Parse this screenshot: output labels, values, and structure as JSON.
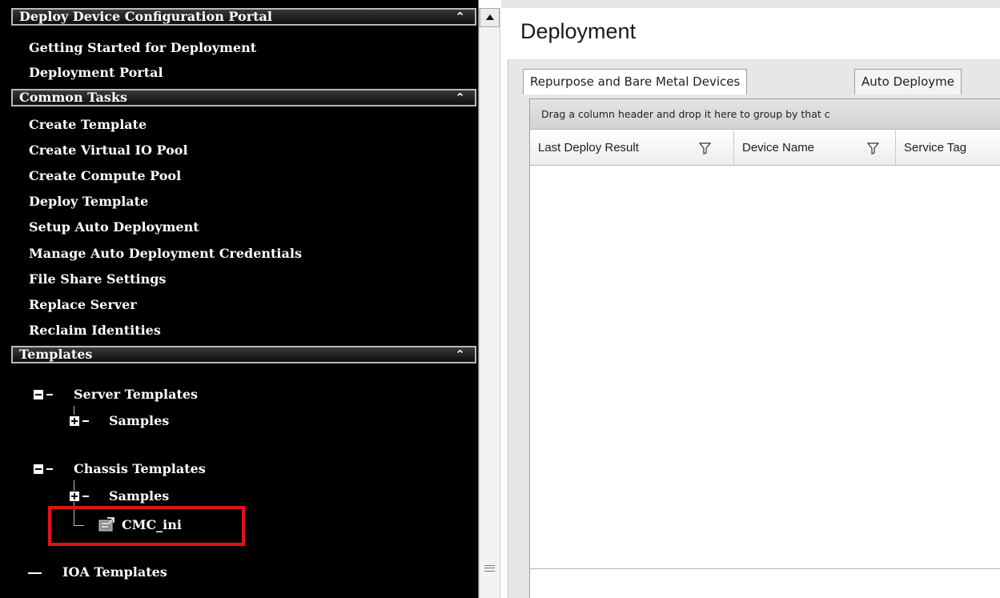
{
  "sidebar": {
    "sections": [
      {
        "title": "Deploy Device Configuration Portal",
        "items": [
          "Getting Started for Deployment",
          "Deployment Portal"
        ]
      },
      {
        "title": "Common Tasks",
        "items": [
          "Create Template",
          "Create Virtual IO Pool",
          "Create Compute Pool",
          "Deploy Template",
          "Setup Auto Deployment",
          "Manage Auto Deployment Credentials",
          "File Share Settings",
          "Replace Server",
          "Reclaim Identities"
        ]
      },
      {
        "title": "Templates"
      }
    ],
    "tree": {
      "server_templates": "Server Templates",
      "server_samples": "Samples",
      "chassis_templates": "Chassis Templates",
      "chassis_samples": "Samples",
      "cmc_ini": "CMC_ini",
      "ioa_templates": "IOA Templates"
    },
    "icons": {
      "collapse": "collapse-minus-icon",
      "expand": "expand-plus-icon",
      "section_chevron": "chevron-up-icon",
      "template_file": "template-file-icon"
    }
  },
  "main": {
    "title": "Deployment",
    "tabs": [
      "Repurpose and Bare Metal Devices",
      "Auto Deployme"
    ],
    "grid": {
      "group_hint": "Drag a column header and drop it here to group by that c",
      "columns": [
        "Last Deploy Result",
        "Device Name",
        "Service Tag"
      ]
    }
  },
  "colors": {
    "sidebar_bg": "#000000",
    "highlight": "#e3111b",
    "panel_bg": "#e7e7e7"
  }
}
